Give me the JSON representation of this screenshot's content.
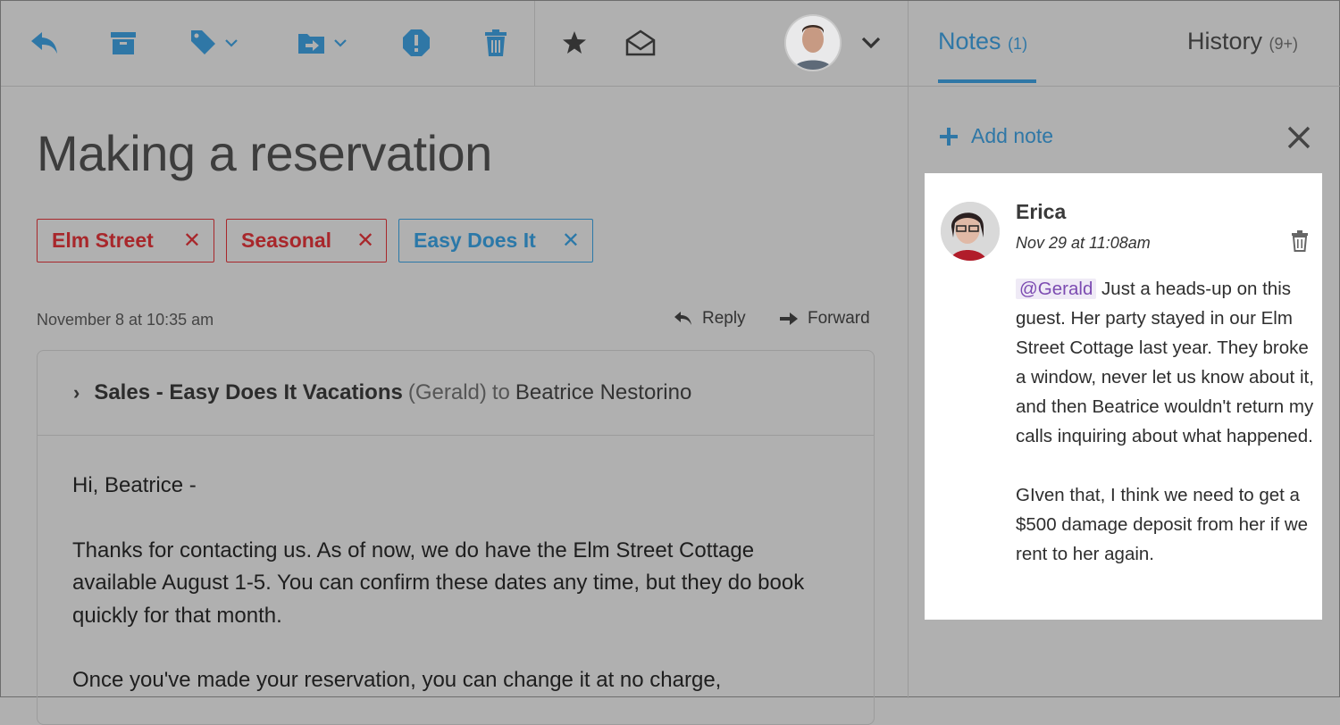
{
  "toolbar": {
    "icons": [
      "reply-icon",
      "archive-icon",
      "tag-icon",
      "move-to-folder-icon",
      "spam-icon",
      "trash-icon",
      "star-icon",
      "mark-unread-icon",
      "user-avatar",
      "chevron-down-icon"
    ],
    "accent": "#2f77a6"
  },
  "email": {
    "subject": "Making a reservation",
    "tags": [
      {
        "label": "Elm Street",
        "color": "#a8272b"
      },
      {
        "label": "Seasonal",
        "color": "#a8272b"
      },
      {
        "label": "Easy Does It",
        "color": "#2b78a8"
      }
    ],
    "tag_remove": "✕",
    "date": "November 8 at 10:35 am",
    "reply_label": "Reply",
    "forward_label": "Forward",
    "message": {
      "sender": "Sales - Easy Does It Vacations",
      "sender_detail": "(Gerald)",
      "to_word": "to",
      "recipient": "Beatrice Nestorino",
      "body": [
        "Hi, Beatrice -",
        "Thanks for contacting us. As of now, we do have the Elm Street Cottage available August 1-5. You can confirm these dates any time, but they do book quickly for that month.",
        "Once you've made your reservation, you can change it at no charge,"
      ]
    }
  },
  "sidebar": {
    "tabs": [
      {
        "label": "Notes",
        "count": "(1)",
        "active": true
      },
      {
        "label": "History",
        "count": "(9+)",
        "active": false
      }
    ],
    "add_note_label": "Add note",
    "note": {
      "author": "Erica",
      "timestamp": "Nov 29 at 11:08am",
      "mention": "@Gerald",
      "paragraph1": " Just a heads-up on this guest. Her party stayed in our Elm Street Cottage last year. They broke a window, never let us know about it, and then Beatrice wouldn't return my calls inquiring about what happened.",
      "paragraph2": "GIven that, I think we need to get a $500 damage deposit from her if we rent to her again."
    }
  }
}
